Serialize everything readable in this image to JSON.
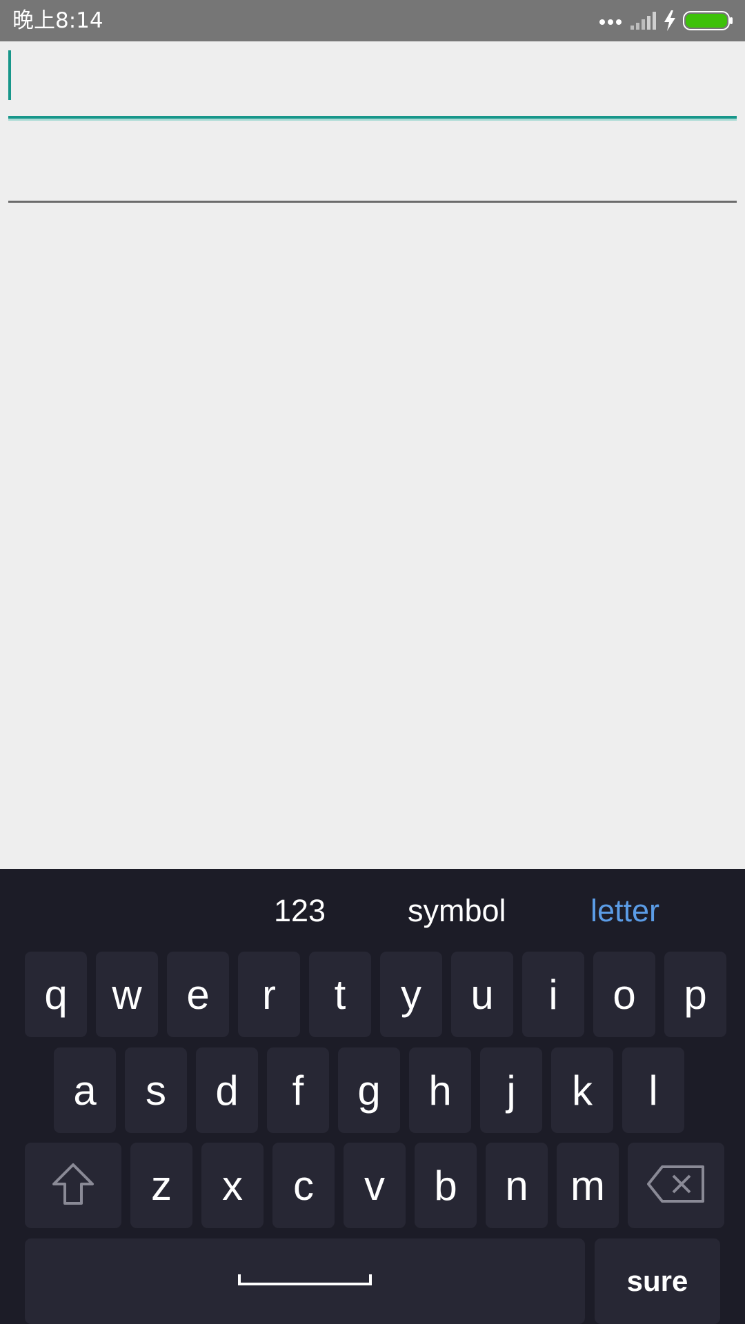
{
  "status_bar": {
    "time": "晚上8:14",
    "icons": [
      "more-dots-icon",
      "signal-icon",
      "charging-icon",
      "battery-icon"
    ],
    "battery_color": "#3ec10a"
  },
  "form": {
    "field_1": {
      "value": "",
      "placeholder": ""
    },
    "field_2": {
      "value": "",
      "placeholder": ""
    },
    "accent_color": "#17968a"
  },
  "keyboard": {
    "modes": {
      "numbers": "123",
      "symbol": "symbol",
      "letter": "letter"
    },
    "active_mode": "letter",
    "row1": [
      "q",
      "w",
      "e",
      "r",
      "t",
      "y",
      "u",
      "i",
      "o",
      "p"
    ],
    "row2": [
      "a",
      "s",
      "d",
      "f",
      "g",
      "h",
      "j",
      "k",
      "l"
    ],
    "row3": [
      "z",
      "x",
      "c",
      "v",
      "b",
      "n",
      "m"
    ],
    "special_icons": [
      "shift-icon",
      "backspace-icon",
      "space-bar-icon"
    ],
    "sure_label": "sure",
    "background": "#1c1c27",
    "key_color": "#272734",
    "active_color": "#5b9ce6"
  }
}
